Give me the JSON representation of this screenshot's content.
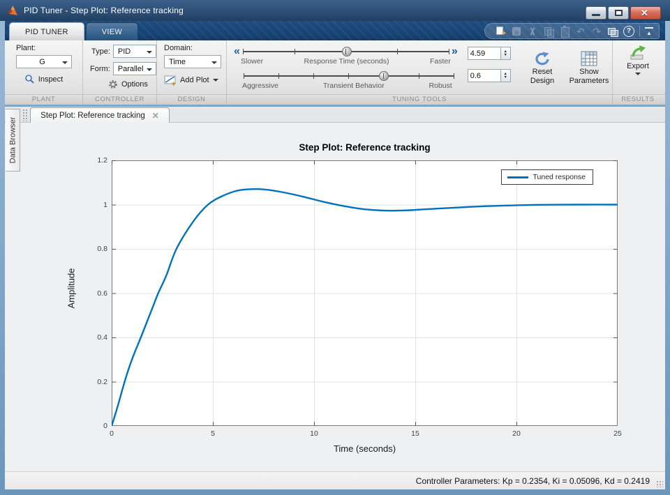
{
  "window": {
    "title": "PID Tuner - Step Plot: Reference tracking",
    "controls": [
      "minimize",
      "restore",
      "close"
    ]
  },
  "ribbon": {
    "tabs": [
      {
        "label": "PID TUNER",
        "active": true
      },
      {
        "label": "VIEW",
        "active": false
      }
    ],
    "quick_access_icons": [
      "new-script",
      "save",
      "cut",
      "copy",
      "paste",
      "undo",
      "redo",
      "window-layout",
      "help"
    ],
    "sections": {
      "plant": "PLANT",
      "controller": "CONTROLLER",
      "design": "DESIGN",
      "tuning": "TUNING TOOLS",
      "results": "RESULTS"
    },
    "plant": {
      "label": "Plant:",
      "value": "G",
      "inspect": "Inspect"
    },
    "controller": {
      "type_label": "Type:",
      "type_value": "PID",
      "form_label": "Form:",
      "form_value": "Parallel",
      "options": "Options"
    },
    "design": {
      "domain_label": "Domain:",
      "domain_value": "Time",
      "add_plot": "Add Plot"
    },
    "tuning": {
      "slider_response": {
        "left": "Slower",
        "center": "Response Time (seconds)",
        "right": "Faster",
        "percent": 50.5,
        "ticks": 5
      },
      "slider_transient": {
        "left": "Aggressive",
        "center": "Transient Behavior",
        "right": "Robust",
        "percent": 66.7,
        "ticks": 7
      },
      "response_time_value": "4.59",
      "transient_behavior_value": "0.6",
      "reset_design": "Reset Design",
      "show_parameters": "Show Parameters"
    },
    "results": {
      "export": "Export"
    }
  },
  "sidebar": {
    "data_browser": "Data Browser"
  },
  "document": {
    "tab": "Step Plot: Reference tracking"
  },
  "chart_data": {
    "type": "line",
    "title": "Step Plot: Reference tracking",
    "xlabel": "Time (seconds)",
    "ylabel": "Amplitude",
    "xlim": [
      0,
      25
    ],
    "ylim": [
      0,
      1.2
    ],
    "xticks": [
      0,
      5,
      10,
      15,
      20,
      25
    ],
    "yticks": [
      0,
      0.2,
      0.4,
      0.6,
      0.8,
      1,
      1.2
    ],
    "grid": true,
    "legend": {
      "position": "top-right",
      "entries": [
        {
          "label": "Tuned response",
          "color": "#0072BD"
        }
      ]
    },
    "series": [
      {
        "name": "Tuned response",
        "color": "#0072BD",
        "x": [
          0,
          0.3,
          0.64,
          1.0,
          1.44,
          2.0,
          2.3,
          2.7,
          3.2,
          4.0,
          4.76,
          5.5,
          6.2,
          6.9,
          7.6,
          8.5,
          9.5,
          10.5,
          11.5,
          12.5,
          13.5,
          14.5,
          15.5,
          16.5,
          17.5,
          18.5,
          19.5,
          21,
          23,
          25
        ],
        "y": [
          0,
          0.09,
          0.2,
          0.3,
          0.4,
          0.53,
          0.6,
          0.68,
          0.8,
          0.92,
          1.0,
          1.04,
          1.063,
          1.07,
          1.068,
          1.055,
          1.035,
          1.012,
          0.993,
          0.979,
          0.973,
          0.974,
          0.979,
          0.984,
          0.989,
          0.993,
          0.996,
          0.999,
          1.0,
          1.0
        ]
      }
    ]
  },
  "statusbar": {
    "text": "Controller Parameters: Kp = 0.2354, Ki = 0.05096, Kd = 0.2419"
  }
}
